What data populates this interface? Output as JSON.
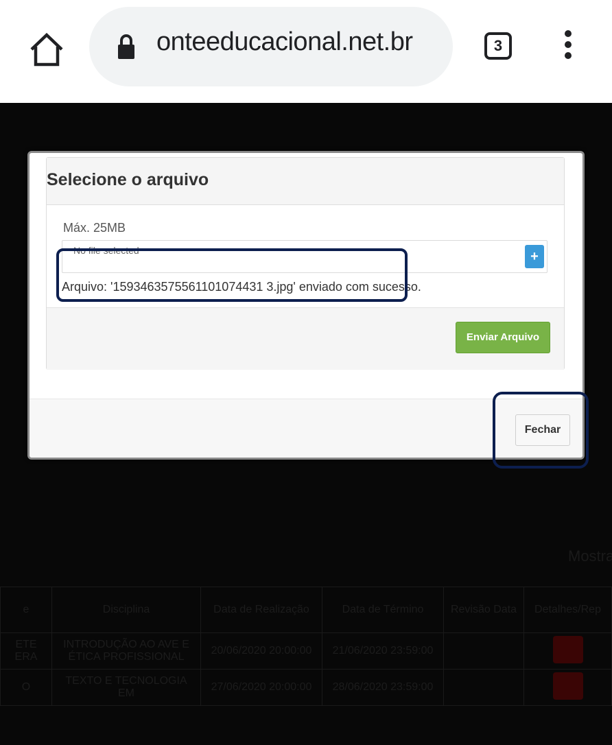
{
  "browser": {
    "url": "onteeducacional.net.br",
    "tab_count": "3"
  },
  "modal": {
    "title": "Selecione o arquivo",
    "max_size": "Máx. 25MB",
    "file_placeholder": "No file selected",
    "plus_label": "+",
    "success_message": "Arquivo: '1593463575561101074431 3.jpg' enviado com sucesso.",
    "send_button": "Enviar Arquivo",
    "close_button": "Fechar"
  },
  "background": {
    "showing_label": "Mostra",
    "table": {
      "headers": [
        "e",
        "Disciplina",
        "Data de Realização",
        "Data de Término",
        "Revisão Data",
        "Detalhes/Rep"
      ],
      "rows": [
        [
          "ETE ERA",
          "INTRODUÇÃO AO AVE E ÉTICA PROFISSIONAL",
          "20/06/2020 20:00:00",
          "21/06/2020 23:59:00",
          "",
          ""
        ],
        [
          "O",
          "TEXTO E TECNOLOGIA EM",
          "27/06/2020 20:00:00",
          "28/06/2020 23:59:00",
          "",
          ""
        ]
      ]
    }
  }
}
